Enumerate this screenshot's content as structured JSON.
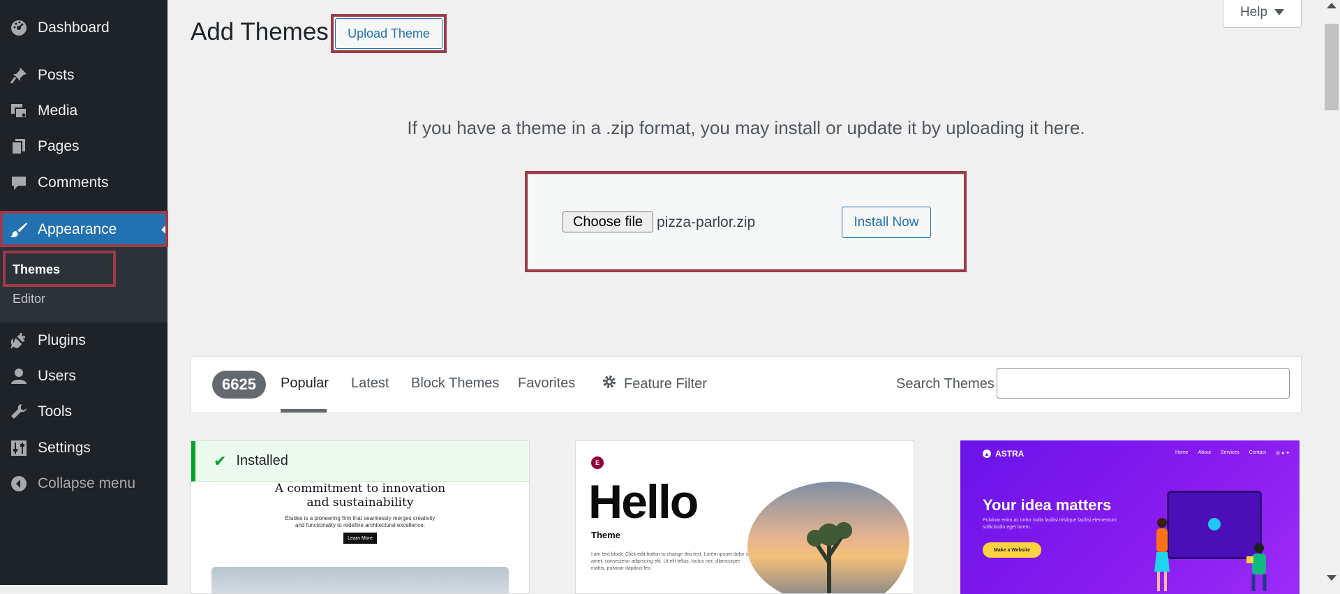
{
  "sidebar": {
    "items": [
      {
        "key": "dashboard",
        "label": "Dashboard",
        "icon": "dashboard-gauge-icon"
      },
      {
        "key": "posts",
        "label": "Posts",
        "icon": "pushpin-icon"
      },
      {
        "key": "media",
        "label": "Media",
        "icon": "media-icon"
      },
      {
        "key": "pages",
        "label": "Pages",
        "icon": "pages-icon"
      },
      {
        "key": "comments",
        "label": "Comments",
        "icon": "comment-bubble-icon"
      },
      {
        "key": "appearance",
        "label": "Appearance",
        "icon": "paintbrush-icon",
        "active": true
      },
      {
        "key": "plugins",
        "label": "Plugins",
        "icon": "plug-icon"
      },
      {
        "key": "users",
        "label": "Users",
        "icon": "user-icon"
      },
      {
        "key": "tools",
        "label": "Tools",
        "icon": "wrench-icon"
      },
      {
        "key": "settings",
        "label": "Settings",
        "icon": "sliders-icon"
      },
      {
        "key": "collapse",
        "label": "Collapse menu",
        "icon": "collapse-arrow-icon"
      }
    ],
    "submenu": [
      {
        "label": "Themes",
        "current": true
      },
      {
        "label": "Editor",
        "current": false
      }
    ]
  },
  "header": {
    "title": "Add Themes",
    "upload_button": "Upload Theme",
    "help": "Help"
  },
  "upload": {
    "intro": "If you have a theme in a .zip format, you may install or update it by uploading it here.",
    "choose_file": "Choose file",
    "file_name": "pizza-parlor.zip",
    "install_button": "Install Now"
  },
  "filter": {
    "count": "6625",
    "tabs": [
      "Popular",
      "Latest",
      "Block Themes",
      "Favorites"
    ],
    "current_tab": "Popular",
    "feature_filter": "Feature Filter",
    "search_label": "Search Themes",
    "search_value": ""
  },
  "themes": [
    {
      "installed_label": "Installed",
      "headline_line1": "A commitment to innovation",
      "headline_line2": "and sustainability",
      "sub_line1": "Études is a pioneering firm that seamlessly merges creativity",
      "sub_line2": "and functionality to redefine architectural excellence.",
      "button": "Learn More"
    },
    {
      "logo": "E",
      "headline": "Hello",
      "subtitle": "Theme",
      "text": "I am text block. Click edit button to change this text. Lorem ipsum dolor sit amet, consectetur adipiscing elit. Ut elit tellus, luctus nec ullamcorper mattis, pulvinar dapibus leo."
    },
    {
      "logo": "ASTRA",
      "nav": [
        "Home",
        "About",
        "Services",
        "Contact"
      ],
      "headline": "Your idea matters",
      "text": "Pulvinar enim ac tortor nulla facilisi tristique facilisi elementum sollicitudin eget lorem.",
      "button": "Make a Website"
    }
  ],
  "colors": {
    "sidebar_bg": "#1d2327",
    "accent": "#2271b1",
    "highlight_border": "#9d3b49",
    "installed_green": "#00a32a"
  }
}
